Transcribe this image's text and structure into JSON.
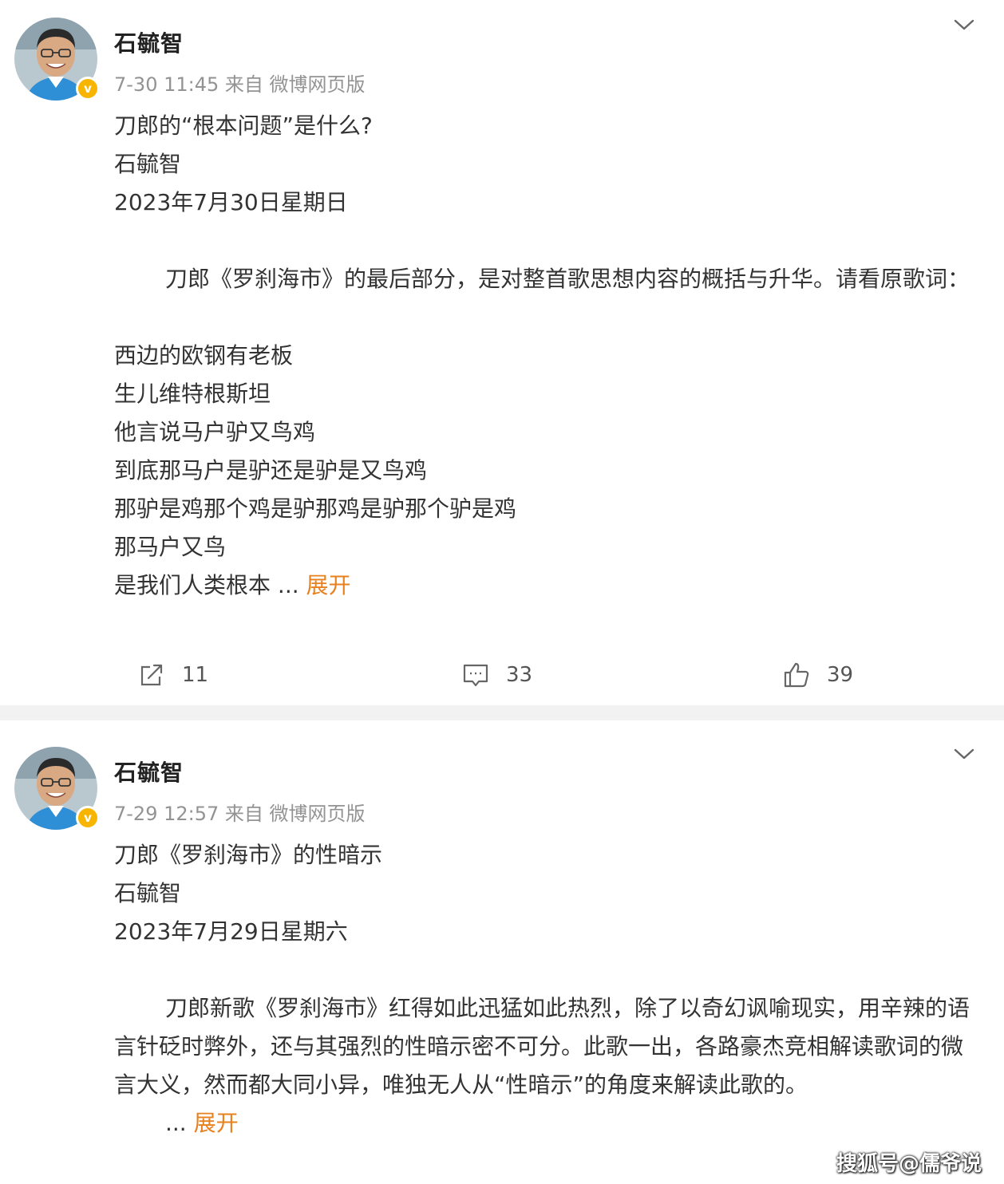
{
  "posts": [
    {
      "author": "石毓智",
      "meta": "7-30 11:45  来自 微博网页版",
      "lines": [
        "刀郎的“根本问题”是什么?",
        "石毓智",
        "2023年7月30日星期日",
        "",
        "刀郎《罗刹海市》的最后部分，是对整首歌思想内容的概括与升华。请看原歌词：",
        "",
        "西边的欧钢有老板",
        "生儿维特根斯坦",
        "他言说马户驴又鸟鸡",
        "到底那马户是驴还是驴是又鸟鸡",
        "那驴是鸡那个鸡是驴那鸡是驴那个驴是鸡",
        "那马户又鸟",
        "是我们人类根本"
      ],
      "ellipsis": " ...",
      "expand_label": "展开",
      "actions": {
        "share_count": "11",
        "comment_count": "33",
        "like_count": "39"
      }
    },
    {
      "author": "石毓智",
      "meta": "7-29 12:57  来自 微博网页版",
      "lines": [
        "刀郎《罗刹海市》的性暗示",
        "石毓智",
        "2023年7月29日星期六",
        "",
        "刀郎新歌《罗刹海市》红得如此迅猛如此热烈，除了以奇幻讽喻现实，用辛辣的语言针砭时弊外，还与其强烈的性暗示密不可分。此歌一出，各路豪杰竞相解读歌词的微言大义，然而都大同小异，唯独无人从“性暗示”的角度来解读此歌的。"
      ],
      "ellipsis": "...",
      "expand_label": "展开"
    }
  ],
  "icons": {
    "avatar_badge": "verified-v-icon",
    "menu": "chevron-down-icon",
    "share": "share-icon",
    "comment": "comment-icon",
    "like": "thumbs-up-icon"
  },
  "colors": {
    "expand_link": "#e8801e",
    "badge": "#f7b500",
    "divider": "#f2f2f2",
    "meta": "#939393"
  },
  "watermark": "搜狐号@儒爷说"
}
